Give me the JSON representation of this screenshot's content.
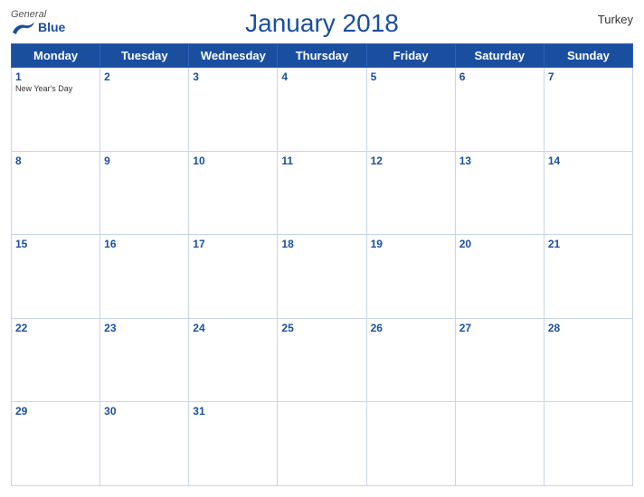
{
  "header": {
    "title": "January 2018",
    "country": "Turkey",
    "logo": {
      "general": "General",
      "blue": "Blue"
    }
  },
  "weekdays": [
    "Monday",
    "Tuesday",
    "Wednesday",
    "Thursday",
    "Friday",
    "Saturday",
    "Sunday"
  ],
  "weeks": [
    [
      {
        "day": "1",
        "holiday": "New Year's Day"
      },
      {
        "day": "2",
        "holiday": ""
      },
      {
        "day": "3",
        "holiday": ""
      },
      {
        "day": "4",
        "holiday": ""
      },
      {
        "day": "5",
        "holiday": ""
      },
      {
        "day": "6",
        "holiday": ""
      },
      {
        "day": "7",
        "holiday": ""
      }
    ],
    [
      {
        "day": "8",
        "holiday": ""
      },
      {
        "day": "9",
        "holiday": ""
      },
      {
        "day": "10",
        "holiday": ""
      },
      {
        "day": "11",
        "holiday": ""
      },
      {
        "day": "12",
        "holiday": ""
      },
      {
        "day": "13",
        "holiday": ""
      },
      {
        "day": "14",
        "holiday": ""
      }
    ],
    [
      {
        "day": "15",
        "holiday": ""
      },
      {
        "day": "16",
        "holiday": ""
      },
      {
        "day": "17",
        "holiday": ""
      },
      {
        "day": "18",
        "holiday": ""
      },
      {
        "day": "19",
        "holiday": ""
      },
      {
        "day": "20",
        "holiday": ""
      },
      {
        "day": "21",
        "holiday": ""
      }
    ],
    [
      {
        "day": "22",
        "holiday": ""
      },
      {
        "day": "23",
        "holiday": ""
      },
      {
        "day": "24",
        "holiday": ""
      },
      {
        "day": "25",
        "holiday": ""
      },
      {
        "day": "26",
        "holiday": ""
      },
      {
        "day": "27",
        "holiday": ""
      },
      {
        "day": "28",
        "holiday": ""
      }
    ],
    [
      {
        "day": "29",
        "holiday": ""
      },
      {
        "day": "30",
        "holiday": ""
      },
      {
        "day": "31",
        "holiday": ""
      },
      {
        "day": "",
        "holiday": ""
      },
      {
        "day": "",
        "holiday": ""
      },
      {
        "day": "",
        "holiday": ""
      },
      {
        "day": "",
        "holiday": ""
      }
    ]
  ]
}
